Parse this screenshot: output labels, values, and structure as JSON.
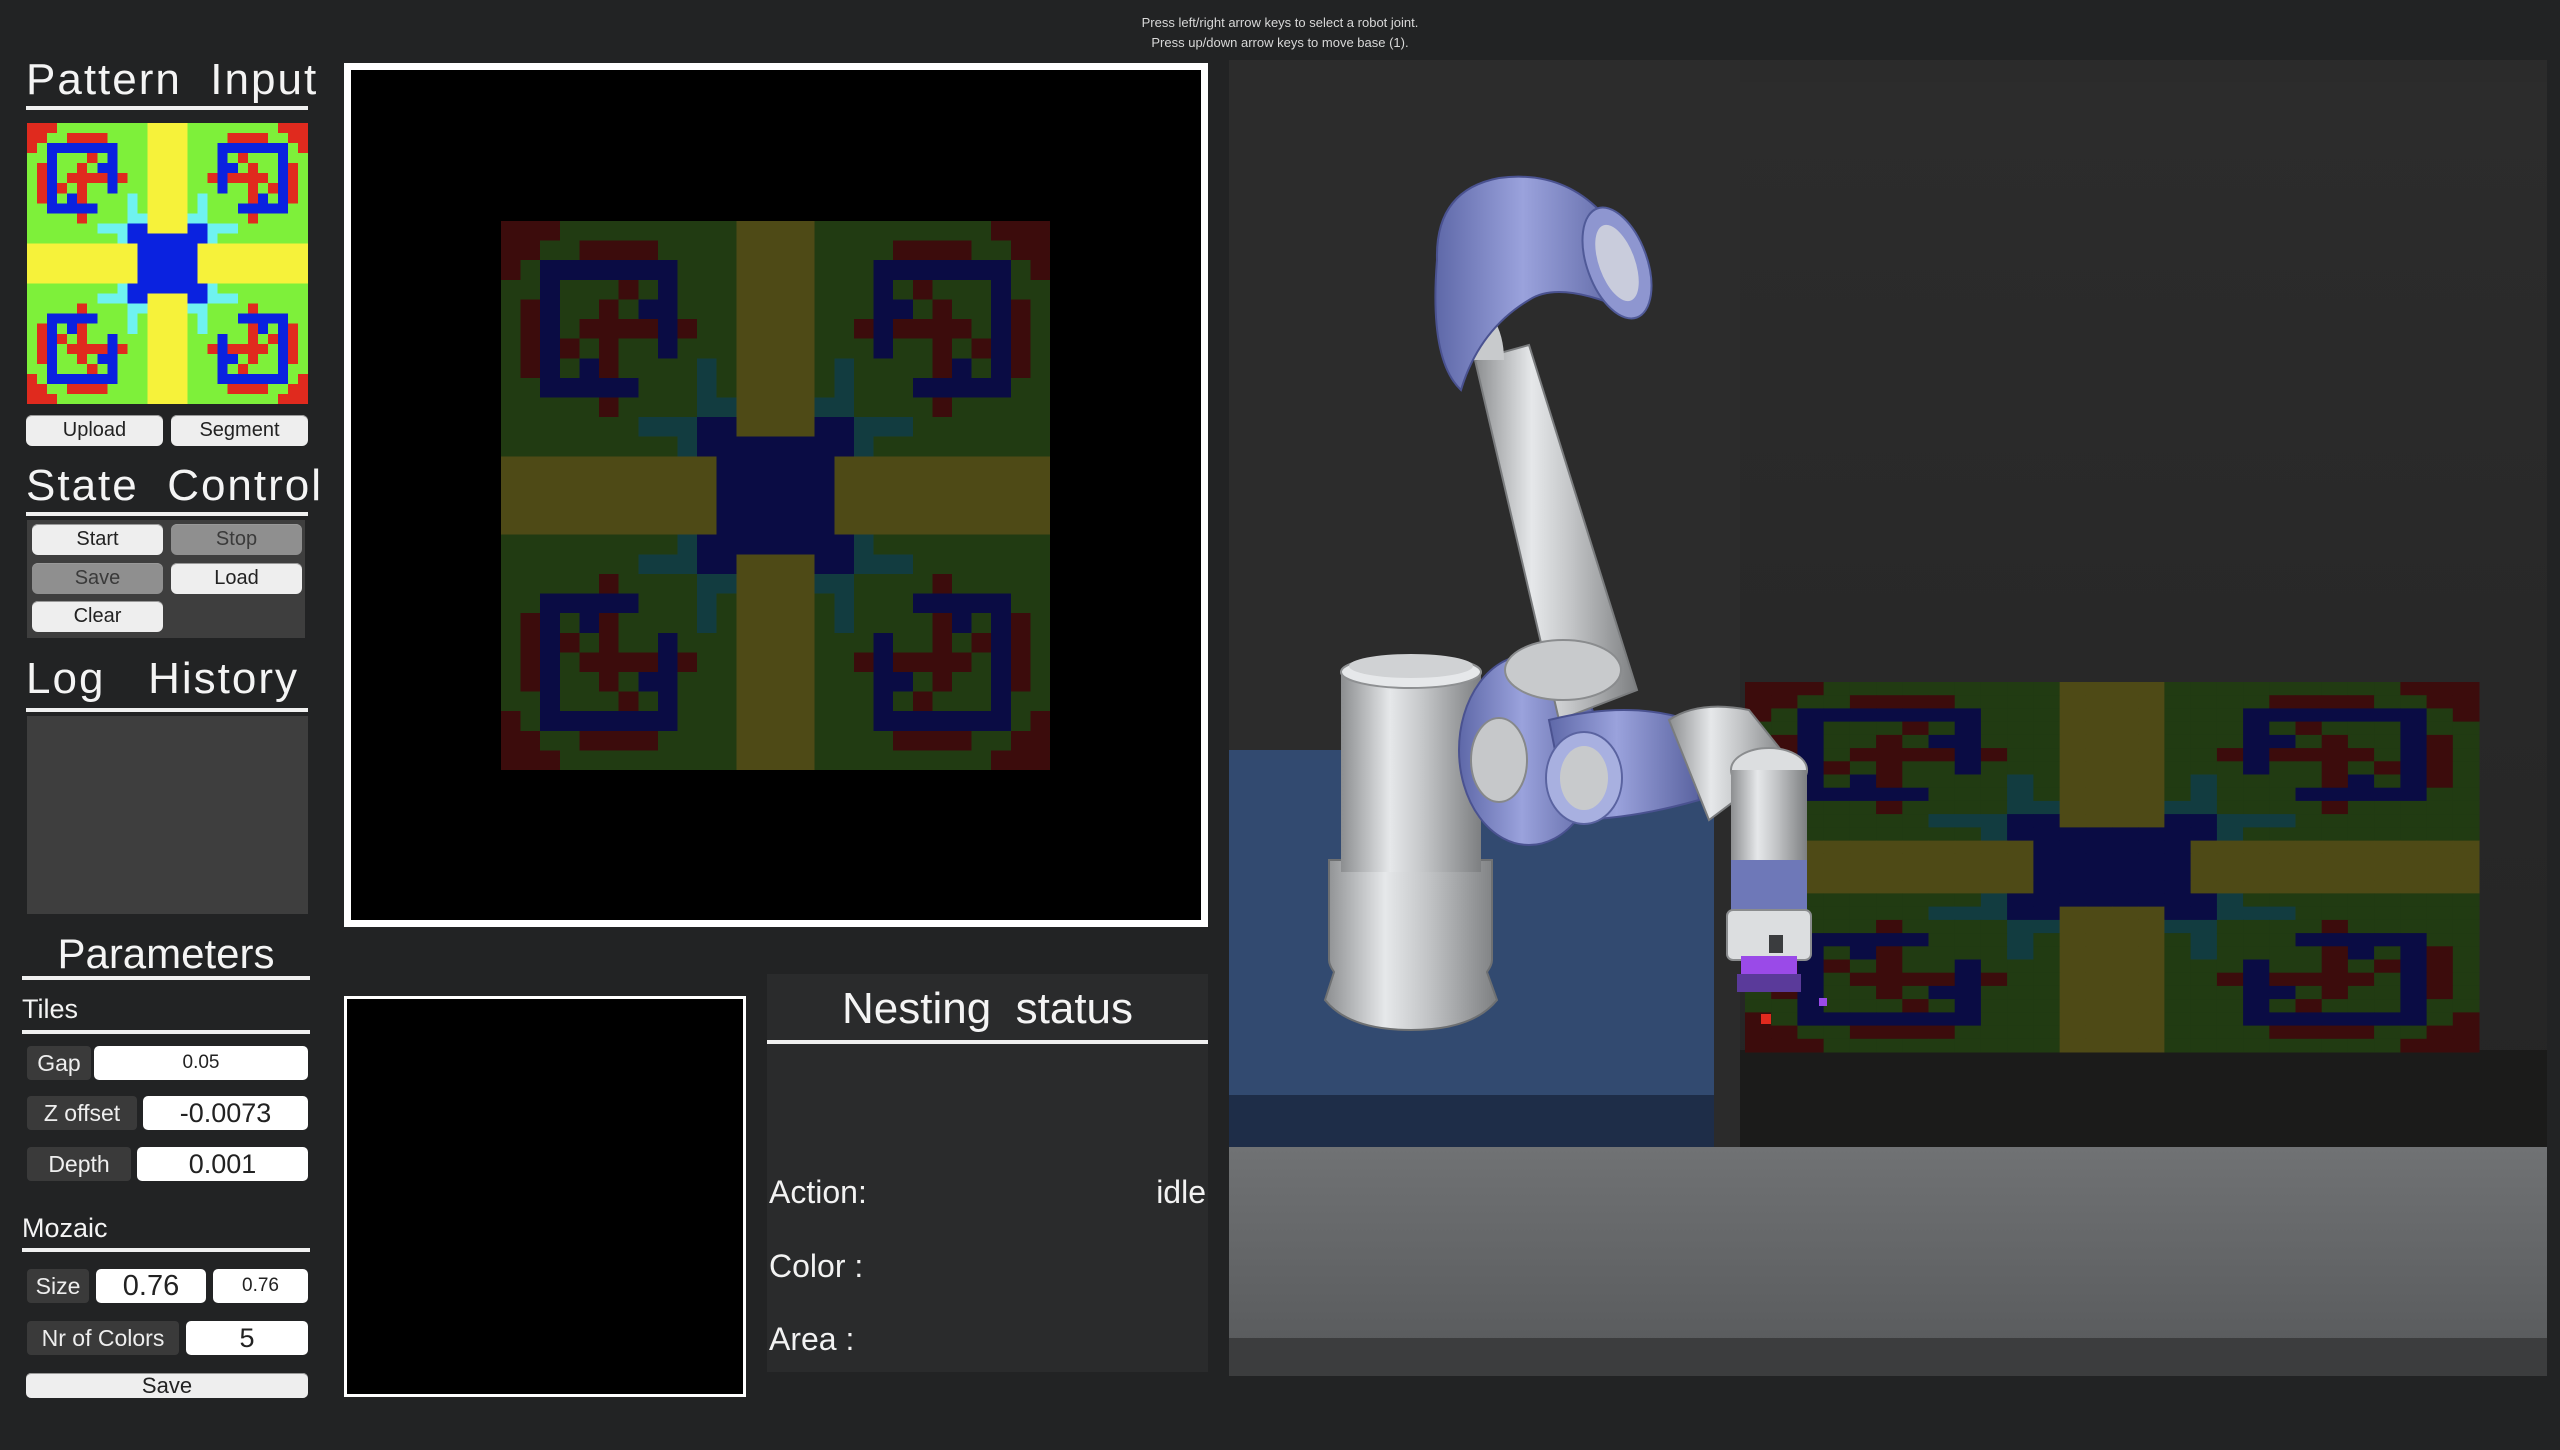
{
  "hints": {
    "line1": "Press left/right arrow keys to select a robot joint.",
    "line2": "Press up/down arrow keys to move base (1)."
  },
  "pattern_input": {
    "title": "Pattern  Input",
    "upload_label": "Upload",
    "segment_label": "Segment"
  },
  "state_control": {
    "title": "State  Control",
    "start_label": "Start",
    "stop_label": "Stop",
    "save_label": "Save",
    "load_label": "Load",
    "clear_label": "Clear"
  },
  "log_history": {
    "title": "Log   History"
  },
  "parameters": {
    "title": "Parameters",
    "tiles_label": "Tiles",
    "gap_label": "Gap",
    "gap_value": "0.05",
    "z_offset_label": "Z offset",
    "z_offset_value": "-0.0073",
    "depth_label": "Depth",
    "depth_value": "0.001",
    "mozaic_label": "Mozaic",
    "size_label": "Size",
    "size_x_value": "0.76",
    "size_y_value": "0.76",
    "nr_colors_label": "Nr of Colors",
    "nr_colors_value": "5",
    "save_label": "Save"
  },
  "nesting_status": {
    "title": "Nesting  status",
    "action_label": "Action:",
    "action_value": "idle",
    "color_label": "Color :",
    "area_label": "Area :"
  },
  "colors": {
    "pattern_blue": "#0a22e0",
    "pattern_red": "#e02a1e",
    "pattern_green": "#7ef03a",
    "pattern_yellow": "#f6f23a",
    "pattern_cyan": "#6ff2f0",
    "mosaic_red": "#3c0c0c",
    "mosaic_green": "#213b12",
    "mosaic_olive": "#4e4a16",
    "mosaic_navy": "#0a0c44",
    "mosaic_teal": "#123c40",
    "robot_blue": "#7c86c8",
    "robot_silver": "#c8cacc"
  }
}
